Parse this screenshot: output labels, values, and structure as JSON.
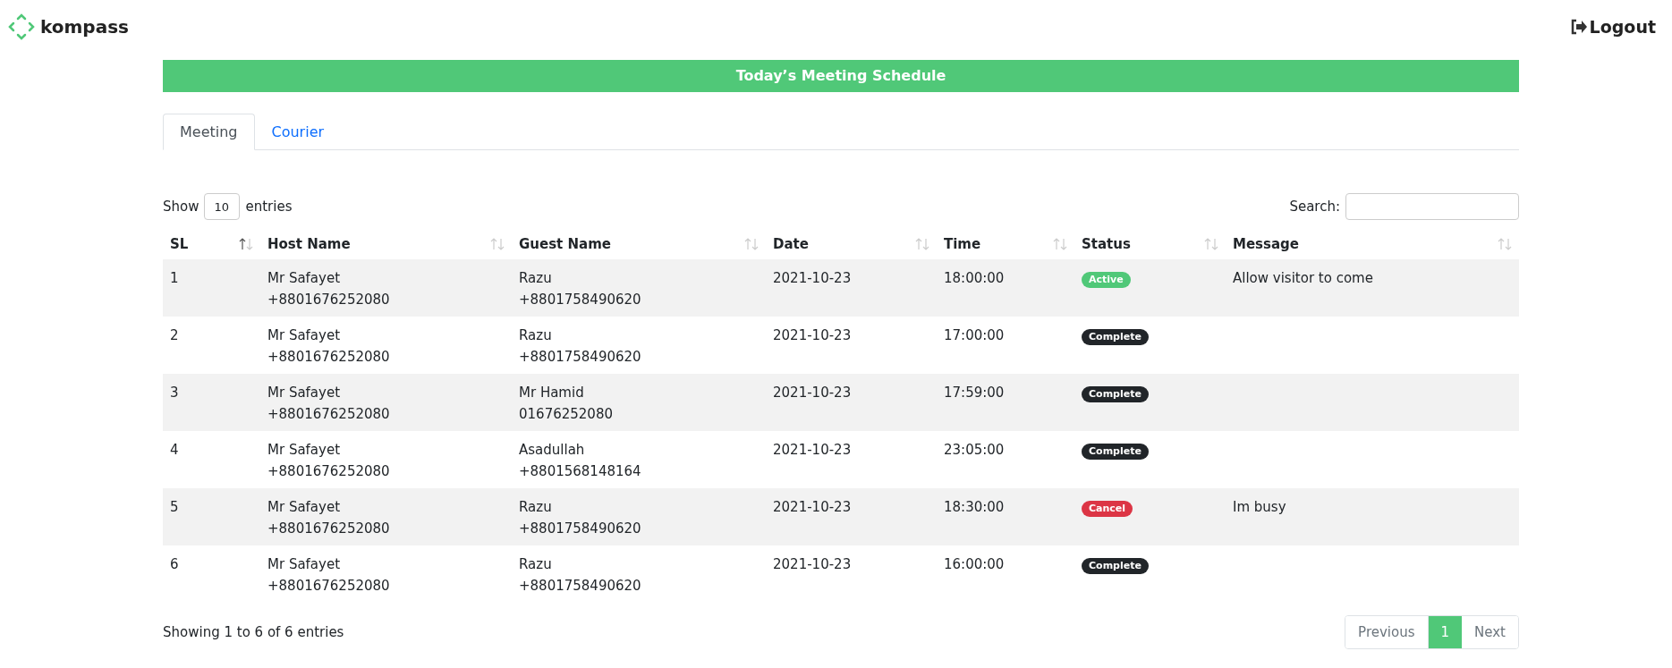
{
  "brand": {
    "name": "kompass"
  },
  "logout": {
    "label": "Logout"
  },
  "banner": {
    "title": "Today’s Meeting Schedule"
  },
  "tabs": [
    {
      "label": "Meeting",
      "selected": true
    },
    {
      "label": "Courier",
      "selected": false
    }
  ],
  "length_control": {
    "prefix": "Show",
    "value": "10",
    "suffix": "entries"
  },
  "search": {
    "label": "Search:"
  },
  "table": {
    "columns": [
      {
        "label": "SL",
        "sorted": true
      },
      {
        "label": "Host Name",
        "sorted": false
      },
      {
        "label": "Guest Name",
        "sorted": false
      },
      {
        "label": "Date",
        "sorted": false
      },
      {
        "label": "Time",
        "sorted": false
      },
      {
        "label": "Status",
        "sorted": false
      },
      {
        "label": "Message",
        "sorted": false
      }
    ],
    "rows": [
      {
        "sl": "1",
        "host": [
          "Mr Safayet",
          "+8801676252080"
        ],
        "guest": [
          "Razu",
          "+8801758490620"
        ],
        "date": "2021-10-23",
        "time": "18:00:00",
        "status": {
          "label": "Active",
          "kind": "active"
        },
        "message": "Allow visitor to come"
      },
      {
        "sl": "2",
        "host": [
          "Mr Safayet",
          "+8801676252080"
        ],
        "guest": [
          "Razu",
          "+8801758490620"
        ],
        "date": "2021-10-23",
        "time": "17:00:00",
        "status": {
          "label": "Complete",
          "kind": "complete"
        }
      },
      {
        "sl": "3",
        "host": [
          "Mr Safayet",
          "+8801676252080"
        ],
        "guest": [
          "Mr Hamid",
          "01676252080"
        ],
        "date": "2021-10-23",
        "time": "17:59:00",
        "status": {
          "label": "Complete",
          "kind": "complete"
        }
      },
      {
        "sl": "4",
        "host": [
          "Mr Safayet",
          "+8801676252080"
        ],
        "guest": [
          "Asadullah",
          "+8801568148164"
        ],
        "date": "2021-10-23",
        "time": "23:05:00",
        "status": {
          "label": "Complete",
          "kind": "complete"
        }
      },
      {
        "sl": "5",
        "host": [
          "Mr Safayet",
          "+8801676252080"
        ],
        "guest": [
          "Razu",
          "+8801758490620"
        ],
        "date": "2021-10-23",
        "time": "18:30:00",
        "status": {
          "label": "Cancel",
          "kind": "cancel"
        },
        "message": "Im busy"
      },
      {
        "sl": "6",
        "host": [
          "Mr Safayet",
          "+8801676252080"
        ],
        "guest": [
          "Razu",
          "+8801758490620"
        ],
        "date": "2021-10-23",
        "time": "16:00:00",
        "status": {
          "label": "Complete",
          "kind": "complete"
        }
      }
    ]
  },
  "info": "Showing 1 to 6 of 6 entries",
  "pagination": {
    "previous": "Previous",
    "pages": [
      {
        "label": "1",
        "selected": true
      }
    ],
    "next": "Next"
  }
}
